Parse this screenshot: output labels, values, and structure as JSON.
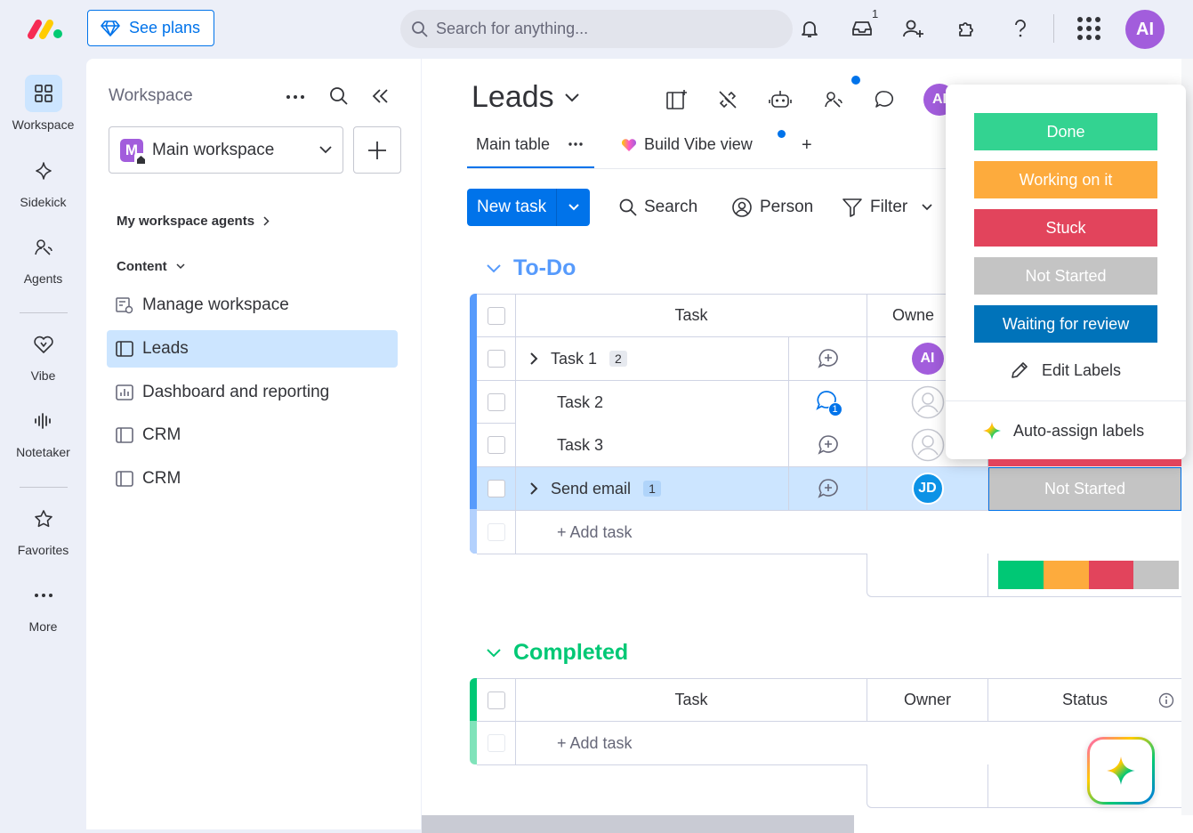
{
  "topbar": {
    "see_plans": "See plans",
    "search_placeholder": "Search for anything...",
    "inbox_count": "1",
    "user_initials": "AI"
  },
  "leftnav": {
    "items": [
      {
        "label": "Workspace",
        "icon": "grid-icon"
      },
      {
        "label": "Sidekick",
        "icon": "sparkle-icon"
      },
      {
        "label": "Agents",
        "icon": "agent-icon"
      },
      {
        "label": "Vibe",
        "icon": "heart-icon"
      },
      {
        "label": "Notetaker",
        "icon": "waveform-icon"
      },
      {
        "label": "Favorites",
        "icon": "star-icon"
      },
      {
        "label": "More",
        "icon": "more-dots-icon"
      }
    ]
  },
  "sidebar": {
    "title": "Workspace",
    "workspace_name": "Main workspace",
    "workspace_initial": "M",
    "agents_label": "My workspace agents",
    "content_label": "Content",
    "items": [
      {
        "label": "Manage workspace"
      },
      {
        "label": "Leads"
      },
      {
        "label": "Dashboard and reporting"
      },
      {
        "label": "CRM"
      },
      {
        "label": "CRM"
      }
    ]
  },
  "board": {
    "title": "Leads",
    "tabs": {
      "main": "Main table",
      "vibe": "Build Vibe view",
      "add": "+"
    },
    "toolbar": {
      "new_task": "New task",
      "search": "Search",
      "person": "Person",
      "filter": "Filter"
    },
    "header_avatar": "AI"
  },
  "groups": {
    "todo": {
      "title": "To-Do",
      "color": "#579bfc",
      "columns": {
        "task": "Task",
        "owner": "Owne"
      },
      "rows": [
        {
          "task": "Task 1",
          "subitems": "2",
          "owner": "AI"
        },
        {
          "task": "Task 2",
          "updates": "1"
        },
        {
          "task": "Task 3"
        },
        {
          "task": "Send email",
          "subitems": "1",
          "owner": "JD",
          "status": "Not Started"
        }
      ],
      "add_task": "+ Add task"
    },
    "completed": {
      "title": "Completed",
      "color": "#00c875",
      "columns": {
        "task": "Task",
        "owner": "Owner",
        "status": "Status"
      },
      "add_task": "+ Add task"
    }
  },
  "status_popup": {
    "labels": [
      {
        "label": "Done",
        "color": "#33d391"
      },
      {
        "label": "Working on it",
        "color": "#fdab3d"
      },
      {
        "label": "Stuck",
        "color": "#e2445c"
      },
      {
        "label": "Not Started",
        "color": "#c4c4c4"
      },
      {
        "label": "Waiting for review",
        "color": "#0073ba"
      }
    ],
    "edit_labels": "Edit Labels",
    "auto_assign": "Auto-assign labels"
  },
  "summary_bar": [
    {
      "color": "#00c875",
      "fraction": 0.25
    },
    {
      "color": "#fdab3d",
      "fraction": 0.25
    },
    {
      "color": "#e2445c",
      "fraction": 0.25
    },
    {
      "color": "#c4c4c4",
      "fraction": 0.25
    }
  ]
}
